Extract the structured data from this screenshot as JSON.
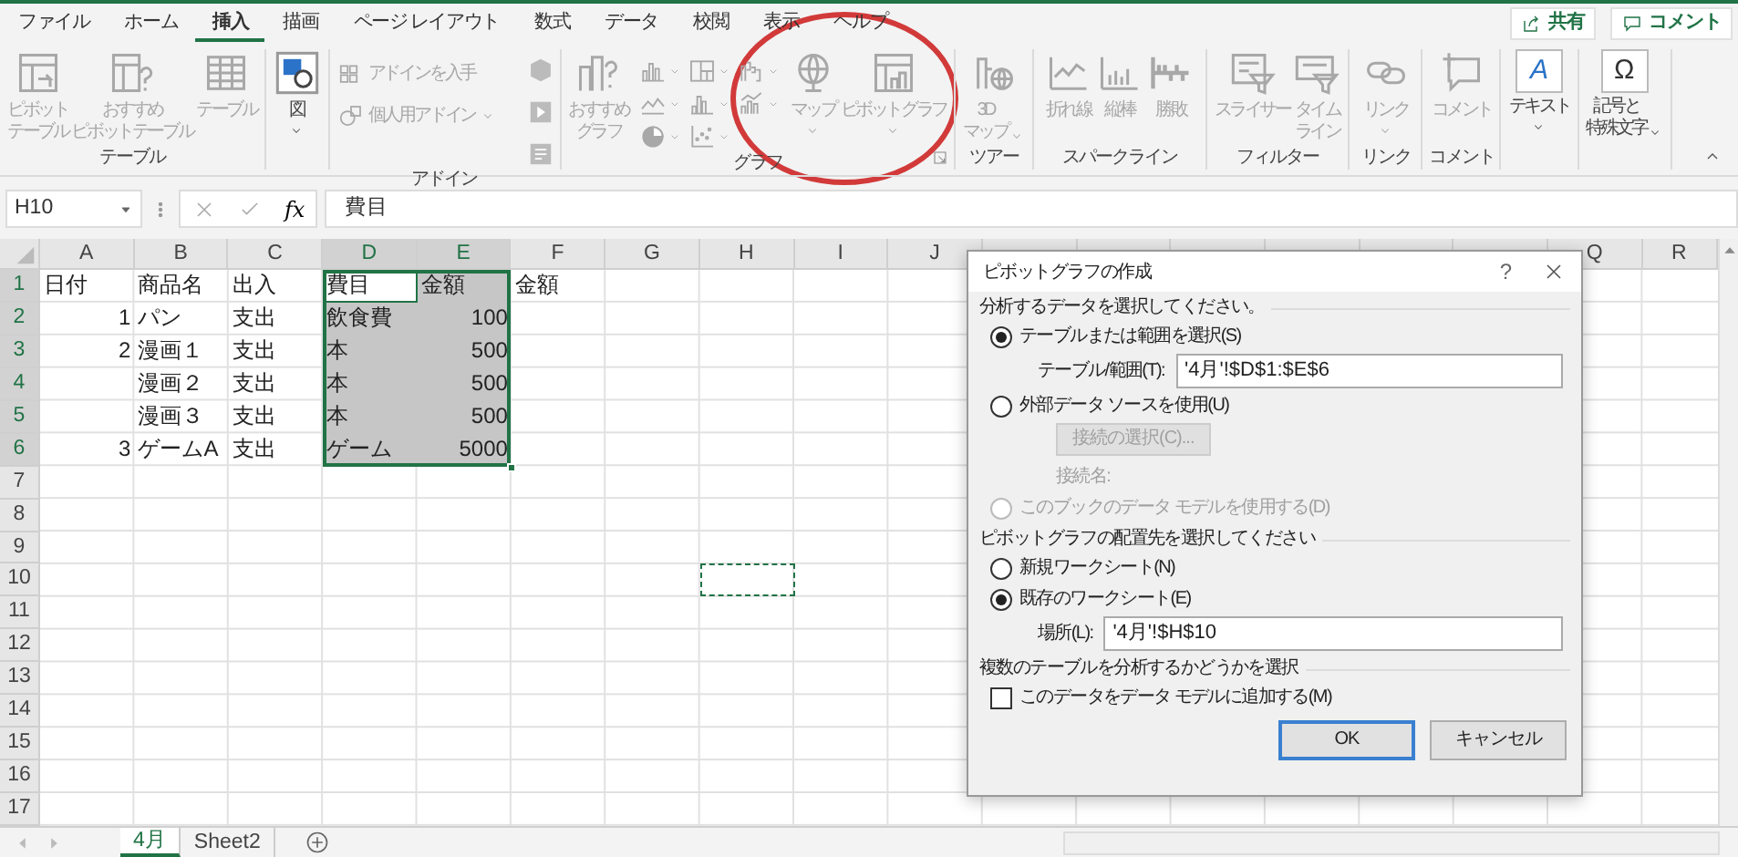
{
  "ribbon_tabs": [
    {
      "label": "ファイル",
      "selected": false
    },
    {
      "label": "ホーム",
      "selected": false
    },
    {
      "label": "挿入",
      "selected": true
    },
    {
      "label": "描画",
      "selected": false
    },
    {
      "label": "ページ レイアウト",
      "selected": false
    },
    {
      "label": "数式",
      "selected": false
    },
    {
      "label": "データ",
      "selected": false
    },
    {
      "label": "校閲",
      "selected": false
    },
    {
      "label": "表示",
      "selected": false
    },
    {
      "label": "ヘルプ",
      "selected": false
    }
  ],
  "header_buttons": [
    {
      "label": "共有"
    },
    {
      "label": "コメント"
    }
  ],
  "ribbon_groups": [
    {
      "label": "テーブル",
      "launcher": false,
      "items": [
        {
          "kind": "large",
          "label": [
            "ピボット",
            "テーブル"
          ],
          "disabled": true,
          "dropdown": false
        },
        {
          "kind": "large",
          "label": [
            "おすすめ",
            "ピボットテーブル"
          ],
          "disabled": true,
          "dropdown": false
        },
        {
          "kind": "large",
          "label": [
            "テーブル"
          ],
          "disabled": true,
          "dropdown": false
        }
      ]
    },
    {
      "launcher": false,
      "items": [
        {
          "kind": "large",
          "label": [
            "図"
          ],
          "disabled": false,
          "dropdown": true
        }
      ]
    },
    {
      "label": "アドイン",
      "launcher": false,
      "items": [
        {
          "kind": "small",
          "label": [
            "アドインを入手"
          ],
          "disabled": true,
          "dropdown": false
        },
        {
          "kind": "small",
          "label": [
            "個人用アドイン"
          ],
          "disabled": true,
          "dropdown": true
        },
        {
          "kind": "icon_column"
        }
      ]
    },
    {
      "label": "グラフ",
      "launcher": true,
      "items": [
        {
          "kind": "large",
          "label": [
            "おすすめ",
            "グラフ"
          ],
          "disabled": true,
          "dropdown": false
        },
        {
          "kind": "icon_grid"
        },
        {
          "kind": "large",
          "label": [
            "マップ"
          ],
          "disabled": true,
          "dropdown": true
        },
        {
          "kind": "large",
          "label": [
            "ピボットグラフ"
          ],
          "disabled": true,
          "dropdown": true
        }
      ]
    },
    {
      "label": "ツアー",
      "launcher": false,
      "items": [
        {
          "kind": "large",
          "label": [
            "3D",
            "マップ"
          ],
          "disabled": true,
          "dropdown": true
        }
      ]
    },
    {
      "label": "スパークライン",
      "launcher": false,
      "items": [
        {
          "kind": "large",
          "label": [
            "折れ線"
          ],
          "disabled": true,
          "dropdown": false
        },
        {
          "kind": "large",
          "label": [
            "縦棒"
          ],
          "disabled": true,
          "dropdown": false
        },
        {
          "kind": "large",
          "label": [
            "勝敗"
          ],
          "disabled": true,
          "dropdown": false
        }
      ]
    },
    {
      "label": "フィルター",
      "launcher": false,
      "items": [
        {
          "kind": "large",
          "label": [
            "スライサー"
          ],
          "disabled": true,
          "dropdown": false
        },
        {
          "kind": "large",
          "label": [
            "タイム",
            "ライン"
          ],
          "disabled": true,
          "dropdown": false
        }
      ]
    },
    {
      "label": "リンク",
      "launcher": false,
      "items": [
        {
          "kind": "large",
          "label": [
            "リンク"
          ],
          "disabled": true,
          "dropdown": true
        }
      ]
    },
    {
      "label": "コメント",
      "launcher": false,
      "items": [
        {
          "kind": "large",
          "label": [
            "コメント"
          ],
          "disabled": true,
          "dropdown": false
        }
      ]
    },
    {
      "launcher": false,
      "items": [
        {
          "kind": "large",
          "label": [
            "テキスト"
          ],
          "symbol": "A",
          "disabled": false,
          "dropdown": true
        }
      ]
    },
    {
      "launcher": false,
      "items": [
        {
          "kind": "large",
          "label": [
            "記号と",
            "特殊文字"
          ],
          "symbol": "Ω",
          "disabled": false,
          "dropdown": true
        }
      ]
    }
  ],
  "formula_bar": {
    "name_box": "H10",
    "function_button": "fx",
    "formula": "費目"
  },
  "sheet": {
    "columns": [
      {
        "label": "A",
        "selected": false
      },
      {
        "label": "B",
        "selected": false
      },
      {
        "label": "C",
        "selected": false
      },
      {
        "label": "D",
        "selected": true
      },
      {
        "label": "E",
        "selected": true
      },
      {
        "label": "F",
        "selected": false
      },
      {
        "label": "G",
        "selected": false
      },
      {
        "label": "H",
        "selected": false
      },
      {
        "label": "I",
        "selected": false
      },
      {
        "label": "J",
        "selected": false
      }
    ],
    "columns_right": [
      {
        "label": "Q",
        "selected": false
      },
      {
        "label": "R",
        "selected": false
      }
    ],
    "rows": [
      {
        "label": "1",
        "selected": true,
        "cells": [
          {
            "kind": "text",
            "value": "日付",
            "selected": false,
            "active": false
          },
          {
            "kind": "text",
            "value": "商品名",
            "selected": false,
            "active": false
          },
          {
            "kind": "text",
            "value": "出入",
            "selected": false,
            "active": false
          },
          {
            "kind": "text",
            "value": "費目",
            "selected": true,
            "active": true
          },
          {
            "kind": "text",
            "value": "金額",
            "selected": true,
            "active": false
          },
          {
            "kind": "text",
            "value": "金額",
            "selected": false,
            "active": false
          }
        ]
      },
      {
        "label": "2",
        "selected": true,
        "cells": [
          {
            "kind": "number",
            "value": "1",
            "selected": false,
            "active": false
          },
          {
            "kind": "text",
            "value": "パン",
            "selected": false,
            "active": false
          },
          {
            "kind": "text",
            "value": "支出",
            "selected": false,
            "active": false
          },
          {
            "kind": "text",
            "value": "飲食費",
            "selected": true,
            "active": false
          },
          {
            "kind": "number",
            "value": "100",
            "selected": true,
            "active": false
          }
        ]
      },
      {
        "label": "3",
        "selected": true,
        "cells": [
          {
            "kind": "number",
            "value": "2",
            "selected": false,
            "active": false
          },
          {
            "kind": "text",
            "value": "漫画１",
            "selected": false,
            "active": false
          },
          {
            "kind": "text",
            "value": "支出",
            "selected": false,
            "active": false
          },
          {
            "kind": "text",
            "value": "本",
            "selected": true,
            "active": false
          },
          {
            "kind": "number",
            "value": "500",
            "selected": true,
            "active": false
          }
        ]
      },
      {
        "label": "4",
        "selected": true,
        "cells": [
          null,
          {
            "kind": "text",
            "value": "漫画２",
            "selected": false,
            "active": false
          },
          {
            "kind": "text",
            "value": "支出",
            "selected": false,
            "active": false
          },
          {
            "kind": "text",
            "value": "本",
            "selected": true,
            "active": false
          },
          {
            "kind": "number",
            "value": "500",
            "selected": true,
            "active": false
          }
        ]
      },
      {
        "label": "5",
        "selected": true,
        "cells": [
          null,
          {
            "kind": "text",
            "value": "漫画３",
            "selected": false,
            "active": false
          },
          {
            "kind": "text",
            "value": "支出",
            "selected": false,
            "active": false
          },
          {
            "kind": "text",
            "value": "本",
            "selected": true,
            "active": false
          },
          {
            "kind": "number",
            "value": "500",
            "selected": true,
            "active": false
          }
        ]
      },
      {
        "label": "6",
        "selected": true,
        "cells": [
          {
            "kind": "number",
            "value": "3",
            "selected": false,
            "active": false
          },
          {
            "kind": "text",
            "value": "ゲームA",
            "selected": false,
            "active": false
          },
          {
            "kind": "text",
            "value": "支出",
            "selected": false,
            "active": false
          },
          {
            "kind": "text",
            "value": "ゲーム",
            "selected": true,
            "active": false
          },
          {
            "kind": "number",
            "value": "5000",
            "selected": true,
            "active": false
          }
        ]
      },
      {
        "label": "7",
        "selected": false
      },
      {
        "label": "8",
        "selected": false
      },
      {
        "label": "9",
        "selected": false
      },
      {
        "label": "10",
        "selected": false,
        "cells": [
          null,
          null,
          null,
          null,
          null,
          null,
          null,
          {
            "kind": "marquee"
          }
        ]
      },
      {
        "label": "11",
        "selected": false
      },
      {
        "label": "12",
        "selected": false
      },
      {
        "label": "13",
        "selected": false
      },
      {
        "label": "14",
        "selected": false
      },
      {
        "label": "15",
        "selected": false
      },
      {
        "label": "16",
        "selected": false
      },
      {
        "label": "17",
        "selected": false
      }
    ]
  },
  "dialog": {
    "title": "ピボットグラフの作成",
    "help": "?",
    "sections": [
      {
        "heading": "分析するデータを選択してください。",
        "items": [
          {
            "kind": "radio",
            "label": "テーブルまたは範囲を選択(S)",
            "checked": true,
            "disabled": false
          },
          {
            "kind": "field",
            "label": "テーブル/範囲(T):",
            "value": "'4月'!$D$1:$E$6"
          },
          {
            "kind": "radio",
            "label": "外部データ ソースを使用(U)",
            "checked": false,
            "disabled": false
          },
          {
            "kind": "button",
            "label": "接続の選択(C)...",
            "disabled": true
          },
          {
            "kind": "note",
            "label": "接続名:",
            "disabled": true
          },
          {
            "kind": "radio",
            "label": "このブックのデータ モデルを使用する(D)",
            "checked": false,
            "disabled": true
          }
        ]
      },
      {
        "heading": "ピボットグラフの配置先を選択してください",
        "items": [
          {
            "kind": "radio",
            "label": "新規ワークシート(N)",
            "checked": false,
            "disabled": false
          },
          {
            "kind": "radio",
            "label": "既存のワークシート(E)",
            "checked": true,
            "disabled": false
          },
          {
            "kind": "field",
            "label": "場所(L):",
            "value": "'4月'!$H$10"
          }
        ]
      },
      {
        "heading": "複数のテーブルを分析するかどうかを選択",
        "items": [
          {
            "kind": "checkbox",
            "label": "このデータをデータ モデルに追加する(M)",
            "checked": false,
            "disabled": false
          }
        ]
      }
    ],
    "buttons": [
      {
        "label": "OK",
        "default": true
      },
      {
        "label": "キャンセル",
        "default": false
      }
    ]
  },
  "sheet_tabs": [
    {
      "label": "4月",
      "selected": true
    },
    {
      "label": "Sheet2",
      "selected": false
    }
  ]
}
